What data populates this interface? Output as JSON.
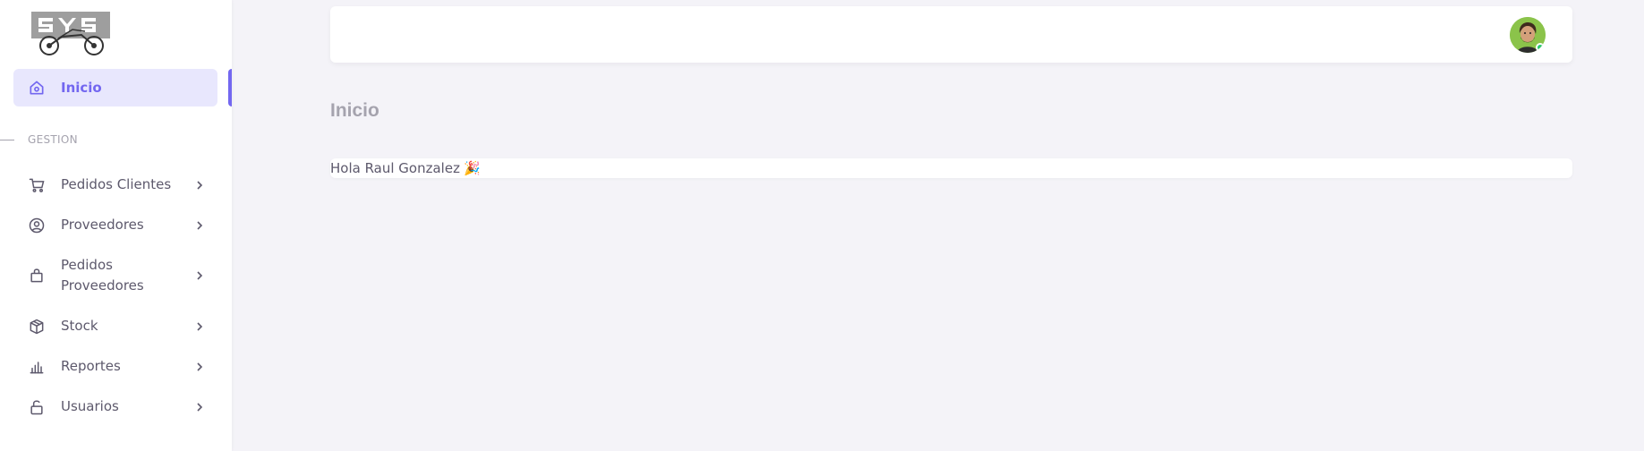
{
  "app": {
    "brand_colors": {
      "accent": "#7367f0",
      "active_bg": "#e8e7fd",
      "status_online": "#28c76f"
    }
  },
  "sidebar": {
    "logo_icon": "sys-motorcycle-logo",
    "active_item": {
      "label": "Inicio",
      "icon": "home-icon"
    },
    "section_header": "GESTION",
    "items": [
      {
        "label": "Pedidos Clientes",
        "icon": "cart-icon"
      },
      {
        "label": "Proveedores",
        "icon": "user-circle-icon"
      },
      {
        "label": "Pedidos\nProveedores",
        "icon": "shopping-bag-icon"
      },
      {
        "label": "Stock",
        "icon": "box-icon"
      },
      {
        "label": "Reportes",
        "icon": "bar-chart-icon"
      },
      {
        "label": "Usuarios",
        "icon": "lock-open-icon"
      }
    ]
  },
  "navbar": {
    "avatar_icon": "user-avatar",
    "status": "online"
  },
  "main": {
    "page_title": "Inicio",
    "greeting": "Hola Raul Gonzalez",
    "greeting_emoji": "🎉"
  }
}
